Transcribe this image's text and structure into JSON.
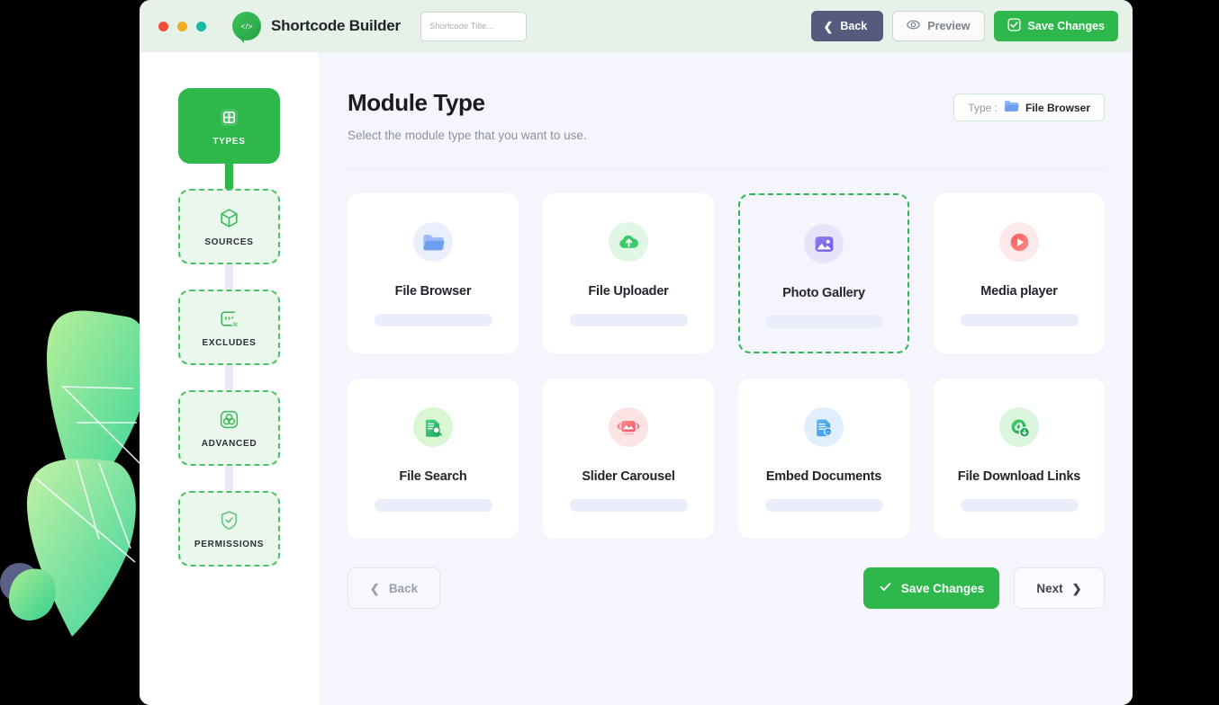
{
  "window": {
    "traffic_lights": [
      "close",
      "minimize",
      "maximize"
    ],
    "brand_title": "Shortcode Builder",
    "logo_icon": "code-chat-bubble-icon",
    "title_input": {
      "value": "",
      "placeholder": "Shortcode Title..."
    }
  },
  "titlebar_actions": {
    "back": {
      "label": "Back",
      "icon": "chevron-left-icon"
    },
    "preview": {
      "label": "Preview",
      "icon": "eye-icon"
    },
    "save": {
      "label": "Save Changes",
      "icon": "check-square-icon"
    }
  },
  "sidebar": {
    "steps": [
      {
        "label": "TYPES",
        "icon": "grid-plus-icon",
        "state": "active"
      },
      {
        "label": "SOURCES",
        "icon": "cube-icon",
        "state": "idle"
      },
      {
        "label": "EXCLUDES",
        "icon": "excludes-box-icon",
        "state": "idle"
      },
      {
        "label": "ADVANCED",
        "icon": "settings-circles-icon",
        "state": "idle"
      },
      {
        "label": "PERMISSIONS",
        "icon": "shield-check-icon",
        "state": "idle"
      }
    ]
  },
  "main": {
    "title": "Module Type",
    "subtitle": "Select the module type that you want to use.",
    "type_badge": {
      "label": "Type :",
      "icon": "folder-icon",
      "value": "File Browser"
    },
    "modules": [
      {
        "title": "File Browser",
        "icon": "folder-icon",
        "selected": false
      },
      {
        "title": "File Uploader",
        "icon": "cloud-upload-icon",
        "selected": false
      },
      {
        "title": "Photo Gallery",
        "icon": "image-gallery-icon",
        "selected": true
      },
      {
        "title": "Media player",
        "icon": "play-circle-icon",
        "selected": false
      },
      {
        "title": "File Search",
        "icon": "document-search-icon",
        "selected": false
      },
      {
        "title": "Slider Carousel",
        "icon": "slider-image-icon",
        "selected": false
      },
      {
        "title": "Embed Documents",
        "icon": "document-code-icon",
        "selected": false
      },
      {
        "title": "File Download Links",
        "icon": "link-download-icon",
        "selected": false
      }
    ],
    "footer": {
      "back": {
        "label": "Back",
        "icon": "chevron-left-icon"
      },
      "save": {
        "label": "Save Changes",
        "icon": "check-icon"
      },
      "next": {
        "label": "Next",
        "icon": "chevron-right-icon"
      }
    }
  },
  "colors": {
    "brand_green": "#2eb84c",
    "titlebar_bg": "#e6f1e8",
    "content_bg": "#f5f6fd",
    "back_button": "#555b7d",
    "dot_red": "#ee4f3b",
    "dot_yellow": "#f0ad1e",
    "dot_green": "#1bb8a3"
  }
}
